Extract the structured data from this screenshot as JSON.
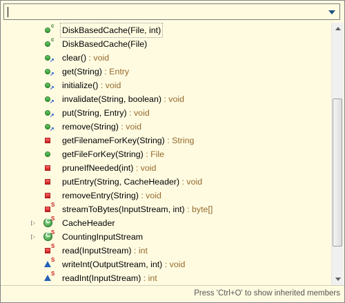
{
  "filter": {
    "value": ""
  },
  "rows": [
    {
      "icon": "public-constructor-icon",
      "name": "DiskBasedCache(File, int)",
      "ret": "",
      "selected": true
    },
    {
      "icon": "public-constructor-icon",
      "name": "DiskBasedCache(File)",
      "ret": ""
    },
    {
      "icon": "public-method-override-icon",
      "name": "clear()",
      "ret": " : void"
    },
    {
      "icon": "public-method-override-icon",
      "name": "get(String)",
      "ret": " : Entry"
    },
    {
      "icon": "public-method-override-icon",
      "name": "initialize()",
      "ret": " : void"
    },
    {
      "icon": "public-method-override-icon",
      "name": "invalidate(String, boolean)",
      "ret": " : void"
    },
    {
      "icon": "public-method-override-icon",
      "name": "put(String, Entry)",
      "ret": " : void"
    },
    {
      "icon": "public-method-override-icon",
      "name": "remove(String)",
      "ret": " : void"
    },
    {
      "icon": "private-method-icon",
      "name": "getFilenameForKey(String)",
      "ret": " : String"
    },
    {
      "icon": "public-method-icon",
      "name": "getFileForKey(String)",
      "ret": " : File"
    },
    {
      "icon": "private-method-icon",
      "name": "pruneIfNeeded(int)",
      "ret": " : void"
    },
    {
      "icon": "private-method-icon",
      "name": "putEntry(String, CacheHeader)",
      "ret": " : void"
    },
    {
      "icon": "private-method-icon",
      "name": "removeEntry(String)",
      "ret": " : void"
    },
    {
      "icon": "private-static-method-icon",
      "name": "streamToBytes(InputStream, int)",
      "ret": " : byte[]"
    },
    {
      "icon": "static-class-icon",
      "name": "CacheHeader",
      "ret": "",
      "expandable": true
    },
    {
      "icon": "static-class-icon",
      "name": "CountingInputStream",
      "ret": "",
      "expandable": true
    },
    {
      "icon": "private-static-method-icon",
      "name": "read(InputStream)",
      "ret": " : int"
    },
    {
      "icon": "protected-static-method-icon",
      "name": "writeInt(OutputStream, int)",
      "ret": " : void"
    },
    {
      "icon": "protected-static-method-icon",
      "name": "readInt(InputStream)",
      "ret": " : int"
    }
  ],
  "status": {
    "hint": "Press 'Ctrl+O' to show inherited members"
  }
}
